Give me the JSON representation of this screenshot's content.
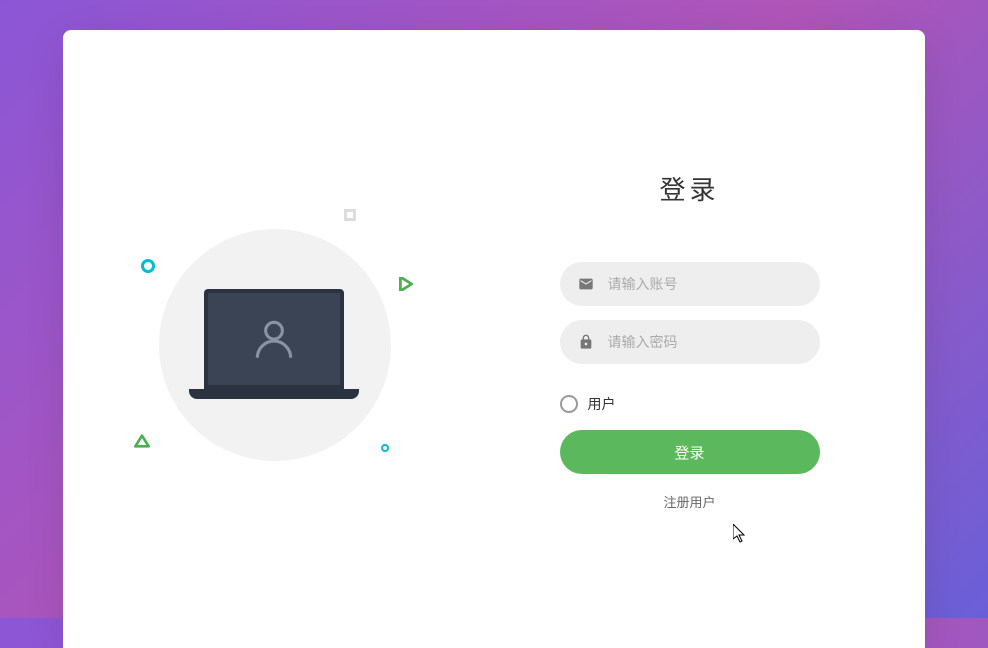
{
  "title": "登录",
  "inputs": {
    "account_placeholder": "请输入账号",
    "password_placeholder": "请输入密码"
  },
  "radio": {
    "user_label": "用户"
  },
  "buttons": {
    "login_label": "登录"
  },
  "links": {
    "register_label": "注册用户"
  },
  "colors": {
    "primary_button": "#5cb85c",
    "input_bg": "#eeeeee",
    "accent_cyan": "#00bcd4"
  }
}
